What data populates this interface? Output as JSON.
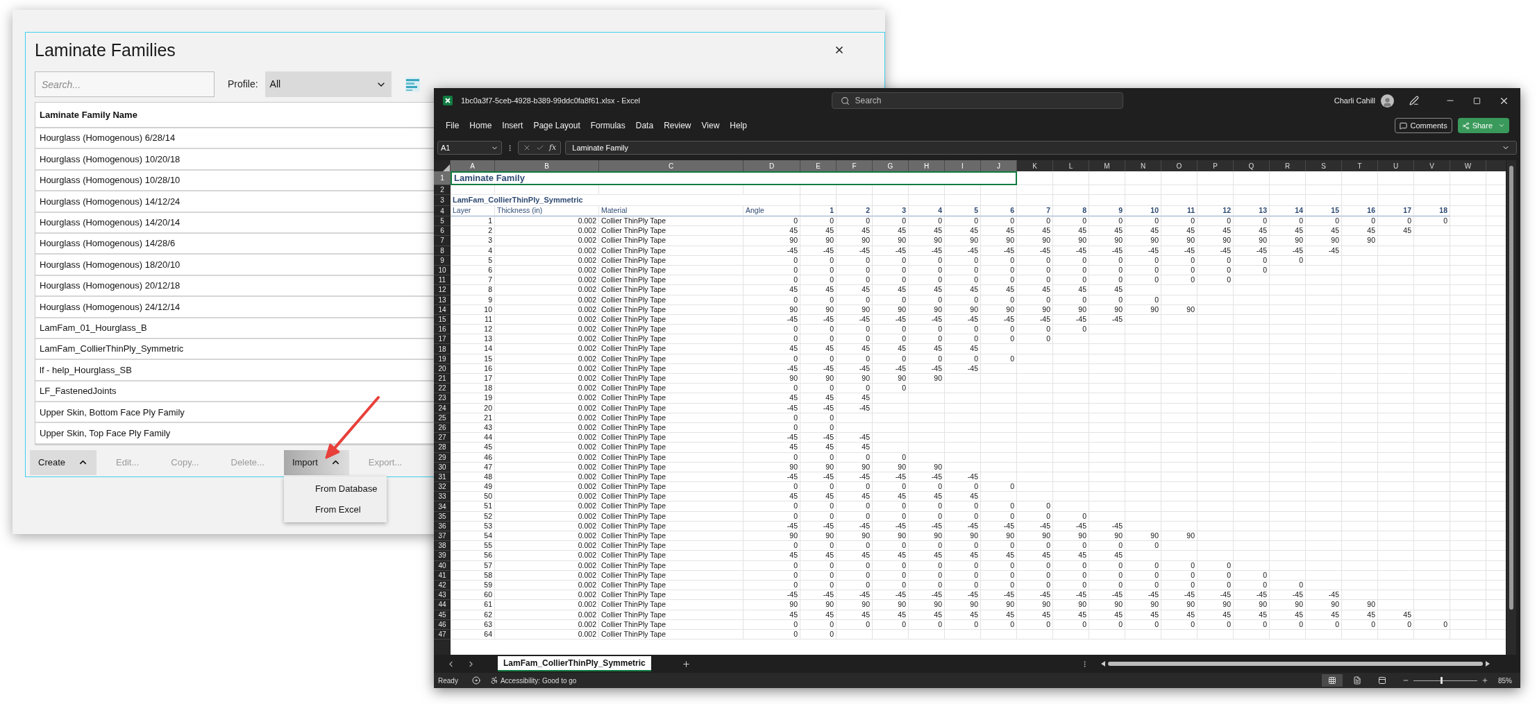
{
  "dialog": {
    "title": "Laminate Families",
    "search_placeholder": "Search...",
    "profile_label": "Profile:",
    "profile_value": "All",
    "column": "Laminate Family Name",
    "rows": [
      {
        "name": "Hourglass (Homogenous) 6/28/14"
      },
      {
        "name": "Hourglass (Homogenous) 10/20/18"
      },
      {
        "name": "Hourglass (Homogenous) 10/28/10"
      },
      {
        "name": "Hourglass (Homogenous) 14/12/24"
      },
      {
        "name": "Hourglass (Homogenous) 14/20/14"
      },
      {
        "name": "Hourglass (Homogenous) 14/28/6"
      },
      {
        "name": "Hourglass (Homogenous) 18/20/10"
      },
      {
        "name": "Hourglass (Homogenous) 20/12/18"
      },
      {
        "name": "Hourglass (Homogenous) 24/12/14"
      },
      {
        "name": "LamFam_01_Hourglass_B"
      },
      {
        "name": "LamFam_CollierThinPly_Symmetric"
      },
      {
        "name": "lf - help_Hourglass_SB"
      },
      {
        "name": "LF_FastenedJoints"
      },
      {
        "name": "Upper Skin, Bottom Face Ply Family"
      },
      {
        "name": "Upper Skin, Top Face Ply Family"
      }
    ],
    "buttons": [
      {
        "label": "Create",
        "kind": "menu",
        "disabled": false,
        "expanded": false
      },
      {
        "label": "Edit...",
        "kind": "plain",
        "disabled": true
      },
      {
        "label": "Copy...",
        "kind": "plain",
        "disabled": true
      },
      {
        "label": "Delete...",
        "kind": "plain",
        "disabled": true
      },
      {
        "label": "Import",
        "kind": "menu",
        "disabled": false,
        "expanded": true,
        "menu": [
          "From Database",
          "From Excel"
        ]
      },
      {
        "label": "Export...",
        "kind": "plain",
        "disabled": true
      }
    ]
  },
  "excel": {
    "title": "1bc0a3f7-5ceb-4928-b389-99ddc0fa8f61.xlsx - Excel",
    "search_placeholder": "Search",
    "user": "Charli Cahill",
    "menu": [
      "File",
      "Home",
      "Insert",
      "Page Layout",
      "Formulas",
      "Data",
      "Review",
      "View",
      "Help"
    ],
    "comments": "Comments",
    "share": "Share",
    "name_box": "A1",
    "function_label": "fx",
    "formula": "Laminate Family",
    "columns": [
      {
        "label": "A",
        "selected": true
      },
      {
        "label": "B",
        "selected": true
      },
      {
        "label": "C",
        "selected": true
      },
      {
        "label": "D",
        "selected": true
      },
      {
        "label": "E",
        "selected": true
      },
      {
        "label": "F",
        "selected": true
      },
      {
        "label": "G",
        "selected": true
      },
      {
        "label": "H",
        "selected": true
      },
      {
        "label": "I",
        "selected": true
      },
      {
        "label": "J",
        "selected": true
      },
      {
        "label": "K",
        "selected": false
      },
      {
        "label": "L",
        "selected": false
      },
      {
        "label": "M",
        "selected": false
      },
      {
        "label": "N",
        "selected": false
      },
      {
        "label": "O",
        "selected": false
      },
      {
        "label": "P",
        "selected": false
      },
      {
        "label": "Q",
        "selected": false
      },
      {
        "label": "R",
        "selected": false
      },
      {
        "label": "S",
        "selected": false
      },
      {
        "label": "T",
        "selected": false
      },
      {
        "label": "U",
        "selected": false
      },
      {
        "label": "V",
        "selected": false
      },
      {
        "label": "W",
        "selected": false
      }
    ],
    "rows": [
      {
        "num": "1",
        "selected": true,
        "kind": "title",
        "text": "Laminate Family"
      },
      {
        "num": "2",
        "selected": false,
        "kind": "blank"
      },
      {
        "num": "3",
        "selected": false,
        "kind": "subtitle",
        "text": "LamFam_CollierThinPly_Symmetric"
      },
      {
        "num": "4",
        "selected": false,
        "kind": "header",
        "cells": [
          "Layer",
          "Thickness (in)",
          "Material",
          "Angle",
          "1",
          "2",
          "3",
          "4",
          "5",
          "6",
          "7",
          "8",
          "9",
          "10",
          "11",
          "12",
          "13",
          "14",
          "15",
          "16",
          "17",
          "18"
        ]
      },
      {
        "num": "5",
        "selected": false,
        "kind": "data",
        "cells": [
          "1",
          "0.002",
          "Collier ThinPly Tape",
          "0",
          "0",
          "0",
          "0",
          "0",
          "0",
          "0",
          "0",
          "0",
          "0",
          "0",
          "0",
          "0",
          "0",
          "0",
          "0",
          "0",
          "0",
          "0"
        ]
      },
      {
        "num": "6",
        "selected": false,
        "kind": "data",
        "cells": [
          "2",
          "0.002",
          "Collier ThinPly Tape",
          "45",
          "45",
          "45",
          "45",
          "45",
          "45",
          "45",
          "45",
          "45",
          "45",
          "45",
          "45",
          "45",
          "45",
          "45",
          "45",
          "45",
          "45"
        ]
      },
      {
        "num": "7",
        "selected": false,
        "kind": "data",
        "cells": [
          "3",
          "0.002",
          "Collier ThinPly Tape",
          "90",
          "90",
          "90",
          "90",
          "90",
          "90",
          "90",
          "90",
          "90",
          "90",
          "90",
          "90",
          "90",
          "90",
          "90",
          "90",
          "90"
        ]
      },
      {
        "num": "8",
        "selected": false,
        "kind": "data",
        "cells": [
          "4",
          "0.002",
          "Collier ThinPly Tape",
          "-45",
          "-45",
          "-45",
          "-45",
          "-45",
          "-45",
          "-45",
          "-45",
          "-45",
          "-45",
          "-45",
          "-45",
          "-45",
          "-45",
          "-45",
          "-45"
        ]
      },
      {
        "num": "9",
        "selected": false,
        "kind": "data",
        "cells": [
          "5",
          "0.002",
          "Collier ThinPly Tape",
          "0",
          "0",
          "0",
          "0",
          "0",
          "0",
          "0",
          "0",
          "0",
          "0",
          "0",
          "0",
          "0",
          "0",
          "0"
        ]
      },
      {
        "num": "10",
        "selected": false,
        "kind": "data",
        "cells": [
          "6",
          "0.002",
          "Collier ThinPly Tape",
          "0",
          "0",
          "0",
          "0",
          "0",
          "0",
          "0",
          "0",
          "0",
          "0",
          "0",
          "0",
          "0",
          "0"
        ]
      },
      {
        "num": "11",
        "selected": false,
        "kind": "data",
        "cells": [
          "7",
          "0.002",
          "Collier ThinPly Tape",
          "0",
          "0",
          "0",
          "0",
          "0",
          "0",
          "0",
          "0",
          "0",
          "0",
          "0",
          "0",
          "0"
        ]
      },
      {
        "num": "12",
        "selected": false,
        "kind": "data",
        "cells": [
          "8",
          "0.002",
          "Collier ThinPly Tape",
          "45",
          "45",
          "45",
          "45",
          "45",
          "45",
          "45",
          "45",
          "45",
          "45"
        ]
      },
      {
        "num": "13",
        "selected": false,
        "kind": "data",
        "cells": [
          "9",
          "0.002",
          "Collier ThinPly Tape",
          "0",
          "0",
          "0",
          "0",
          "0",
          "0",
          "0",
          "0",
          "0",
          "0",
          "0"
        ]
      },
      {
        "num": "14",
        "selected": false,
        "kind": "data",
        "cells": [
          "10",
          "0.002",
          "Collier ThinPly Tape",
          "90",
          "90",
          "90",
          "90",
          "90",
          "90",
          "90",
          "90",
          "90",
          "90",
          "90",
          "90"
        ]
      },
      {
        "num": "15",
        "selected": false,
        "kind": "data",
        "cells": [
          "11",
          "0.002",
          "Collier ThinPly Tape",
          "-45",
          "-45",
          "-45",
          "-45",
          "-45",
          "-45",
          "-45",
          "-45",
          "-45",
          "-45"
        ]
      },
      {
        "num": "16",
        "selected": false,
        "kind": "data",
        "cells": [
          "12",
          "0.002",
          "Collier ThinPly Tape",
          "0",
          "0",
          "0",
          "0",
          "0",
          "0",
          "0",
          "0",
          "0"
        ]
      },
      {
        "num": "17",
        "selected": false,
        "kind": "data",
        "cells": [
          "13",
          "0.002",
          "Collier ThinPly Tape",
          "0",
          "0",
          "0",
          "0",
          "0",
          "0",
          "0",
          "0"
        ]
      },
      {
        "num": "18",
        "selected": false,
        "kind": "data",
        "cells": [
          "14",
          "0.002",
          "Collier ThinPly Tape",
          "45",
          "45",
          "45",
          "45",
          "45",
          "45"
        ]
      },
      {
        "num": "19",
        "selected": false,
        "kind": "data",
        "cells": [
          "15",
          "0.002",
          "Collier ThinPly Tape",
          "0",
          "0",
          "0",
          "0",
          "0",
          "0",
          "0"
        ]
      },
      {
        "num": "20",
        "selected": false,
        "kind": "data",
        "cells": [
          "16",
          "0.002",
          "Collier ThinPly Tape",
          "-45",
          "-45",
          "-45",
          "-45",
          "-45",
          "-45"
        ]
      },
      {
        "num": "21",
        "selected": false,
        "kind": "data",
        "cells": [
          "17",
          "0.002",
          "Collier ThinPly Tape",
          "90",
          "90",
          "90",
          "90",
          "90"
        ]
      },
      {
        "num": "22",
        "selected": false,
        "kind": "data",
        "cells": [
          "18",
          "0.002",
          "Collier ThinPly Tape",
          "0",
          "0",
          "0",
          "0"
        ]
      },
      {
        "num": "23",
        "selected": false,
        "kind": "data",
        "cells": [
          "19",
          "0.002",
          "Collier ThinPly Tape",
          "45",
          "45",
          "45"
        ]
      },
      {
        "num": "24",
        "selected": false,
        "kind": "data",
        "cells": [
          "20",
          "0.002",
          "Collier ThinPly Tape",
          "-45",
          "-45",
          "-45"
        ]
      },
      {
        "num": "25",
        "selected": false,
        "kind": "data",
        "cells": [
          "21",
          "0.002",
          "Collier ThinPly Tape",
          "0",
          "0"
        ]
      },
      {
        "num": "26",
        "selected": false,
        "kind": "data",
        "cells": [
          "43",
          "0.002",
          "Collier ThinPly Tape",
          "0",
          "0"
        ]
      },
      {
        "num": "27",
        "selected": false,
        "kind": "data",
        "cells": [
          "44",
          "0.002",
          "Collier ThinPly Tape",
          "-45",
          "-45",
          "-45"
        ]
      },
      {
        "num": "28",
        "selected": false,
        "kind": "data",
        "cells": [
          "45",
          "0.002",
          "Collier ThinPly Tape",
          "45",
          "45",
          "45"
        ]
      },
      {
        "num": "29",
        "selected": false,
        "kind": "data",
        "cells": [
          "46",
          "0.002",
          "Collier ThinPly Tape",
          "0",
          "0",
          "0",
          "0"
        ]
      },
      {
        "num": "30",
        "selected": false,
        "kind": "data",
        "cells": [
          "47",
          "0.002",
          "Collier ThinPly Tape",
          "90",
          "90",
          "90",
          "90",
          "90"
        ]
      },
      {
        "num": "31",
        "selected": false,
        "kind": "data",
        "cells": [
          "48",
          "0.002",
          "Collier ThinPly Tape",
          "-45",
          "-45",
          "-45",
          "-45",
          "-45",
          "-45"
        ]
      },
      {
        "num": "32",
        "selected": false,
        "kind": "data",
        "cells": [
          "49",
          "0.002",
          "Collier ThinPly Tape",
          "0",
          "0",
          "0",
          "0",
          "0",
          "0",
          "0"
        ]
      },
      {
        "num": "33",
        "selected": false,
        "kind": "data",
        "cells": [
          "50",
          "0.002",
          "Collier ThinPly Tape",
          "45",
          "45",
          "45",
          "45",
          "45",
          "45"
        ]
      },
      {
        "num": "34",
        "selected": false,
        "kind": "data",
        "cells": [
          "51",
          "0.002",
          "Collier ThinPly Tape",
          "0",
          "0",
          "0",
          "0",
          "0",
          "0",
          "0",
          "0"
        ]
      },
      {
        "num": "35",
        "selected": false,
        "kind": "data",
        "cells": [
          "52",
          "0.002",
          "Collier ThinPly Tape",
          "0",
          "0",
          "0",
          "0",
          "0",
          "0",
          "0",
          "0",
          "0"
        ]
      },
      {
        "num": "36",
        "selected": false,
        "kind": "data",
        "cells": [
          "53",
          "0.002",
          "Collier ThinPly Tape",
          "-45",
          "-45",
          "-45",
          "-45",
          "-45",
          "-45",
          "-45",
          "-45",
          "-45",
          "-45"
        ]
      },
      {
        "num": "37",
        "selected": false,
        "kind": "data",
        "cells": [
          "54",
          "0.002",
          "Collier ThinPly Tape",
          "90",
          "90",
          "90",
          "90",
          "90",
          "90",
          "90",
          "90",
          "90",
          "90",
          "90",
          "90"
        ]
      },
      {
        "num": "38",
        "selected": false,
        "kind": "data",
        "cells": [
          "55",
          "0.002",
          "Collier ThinPly Tape",
          "0",
          "0",
          "0",
          "0",
          "0",
          "0",
          "0",
          "0",
          "0",
          "0",
          "0"
        ]
      },
      {
        "num": "39",
        "selected": false,
        "kind": "data",
        "cells": [
          "56",
          "0.002",
          "Collier ThinPly Tape",
          "45",
          "45",
          "45",
          "45",
          "45",
          "45",
          "45",
          "45",
          "45",
          "45"
        ]
      },
      {
        "num": "40",
        "selected": false,
        "kind": "data",
        "cells": [
          "57",
          "0.002",
          "Collier ThinPly Tape",
          "0",
          "0",
          "0",
          "0",
          "0",
          "0",
          "0",
          "0",
          "0",
          "0",
          "0",
          "0",
          "0"
        ]
      },
      {
        "num": "41",
        "selected": false,
        "kind": "data",
        "cells": [
          "58",
          "0.002",
          "Collier ThinPly Tape",
          "0",
          "0",
          "0",
          "0",
          "0",
          "0",
          "0",
          "0",
          "0",
          "0",
          "0",
          "0",
          "0",
          "0"
        ]
      },
      {
        "num": "42",
        "selected": false,
        "kind": "data",
        "cells": [
          "59",
          "0.002",
          "Collier ThinPly Tape",
          "0",
          "0",
          "0",
          "0",
          "0",
          "0",
          "0",
          "0",
          "0",
          "0",
          "0",
          "0",
          "0",
          "0",
          "0"
        ]
      },
      {
        "num": "43",
        "selected": false,
        "kind": "data",
        "cells": [
          "60",
          "0.002",
          "Collier ThinPly Tape",
          "-45",
          "-45",
          "-45",
          "-45",
          "-45",
          "-45",
          "-45",
          "-45",
          "-45",
          "-45",
          "-45",
          "-45",
          "-45",
          "-45",
          "-45",
          "-45"
        ]
      },
      {
        "num": "44",
        "selected": false,
        "kind": "data",
        "cells": [
          "61",
          "0.002",
          "Collier ThinPly Tape",
          "90",
          "90",
          "90",
          "90",
          "90",
          "90",
          "90",
          "90",
          "90",
          "90",
          "90",
          "90",
          "90",
          "90",
          "90",
          "90",
          "90"
        ]
      },
      {
        "num": "45",
        "selected": false,
        "kind": "data",
        "cells": [
          "62",
          "0.002",
          "Collier ThinPly Tape",
          "45",
          "45",
          "45",
          "45",
          "45",
          "45",
          "45",
          "45",
          "45",
          "45",
          "45",
          "45",
          "45",
          "45",
          "45",
          "45",
          "45",
          "45"
        ]
      },
      {
        "num": "46",
        "selected": false,
        "kind": "data",
        "cells": [
          "63",
          "0.002",
          "Collier ThinPly Tape",
          "0",
          "0",
          "0",
          "0",
          "0",
          "0",
          "0",
          "0",
          "0",
          "0",
          "0",
          "0",
          "0",
          "0",
          "0",
          "0",
          "0",
          "0",
          "0"
        ]
      },
      {
        "num": "47",
        "selected": false,
        "kind": "data",
        "cells": [
          "64",
          "0.002",
          "Collier ThinPly Tape",
          "0",
          "0"
        ]
      }
    ],
    "sheet_tabs": [
      {
        "label": "LamFam_CollierThinPly_Symmetric",
        "selected": true
      }
    ],
    "status": "Ready",
    "accessibility": "Accessibility: Good to go",
    "views": [
      {
        "kind": "normal",
        "selected": true
      },
      {
        "kind": "page-layout",
        "selected": false
      },
      {
        "kind": "page-break",
        "selected": false
      }
    ],
    "zoom_slider": {
      "level": 0.42
    },
    "zoom": "85%"
  }
}
